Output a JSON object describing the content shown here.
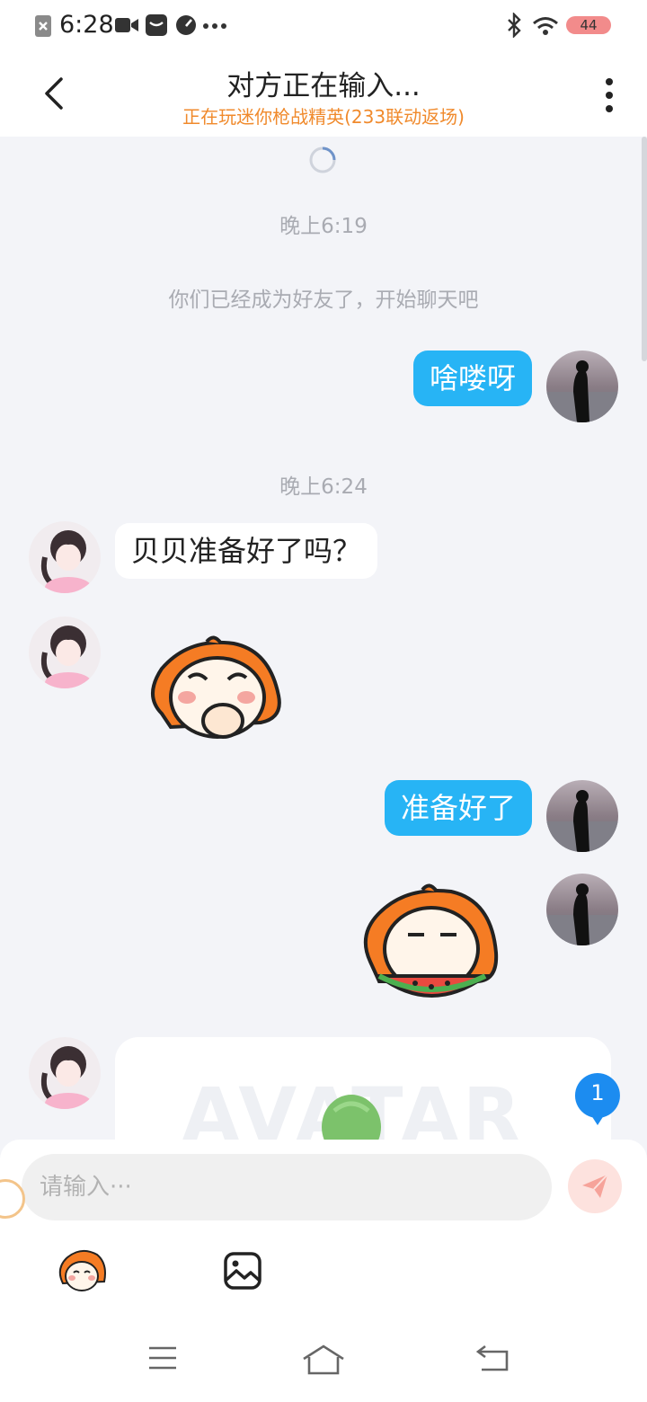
{
  "status_bar": {
    "time": "6:28",
    "battery": "44",
    "icons": [
      "notification-x-icon",
      "video-icon",
      "message-icon",
      "speed-icon",
      "more-dots-icon",
      "bluetooth-icon",
      "wifi-icon",
      "battery-icon"
    ]
  },
  "header": {
    "title": "对方正在输入...",
    "subtitle": "正在玩迷你枪战精英(233联动返场)",
    "subtitle_color": "#f08a2c"
  },
  "chat": {
    "timestamp_1": "晚上6:19",
    "system_message": "你们已经成为好友了，开始聊天吧",
    "msg_1": "啥喽呀",
    "timestamp_2": "晚上6:24",
    "msg_2": "贝贝准备好了吗？",
    "msg_3": "准备好了",
    "card_watermark": "AVATAR",
    "unread_count": "1",
    "outgoing_color": "#27b4f5"
  },
  "input": {
    "placeholder": "请输入···"
  }
}
